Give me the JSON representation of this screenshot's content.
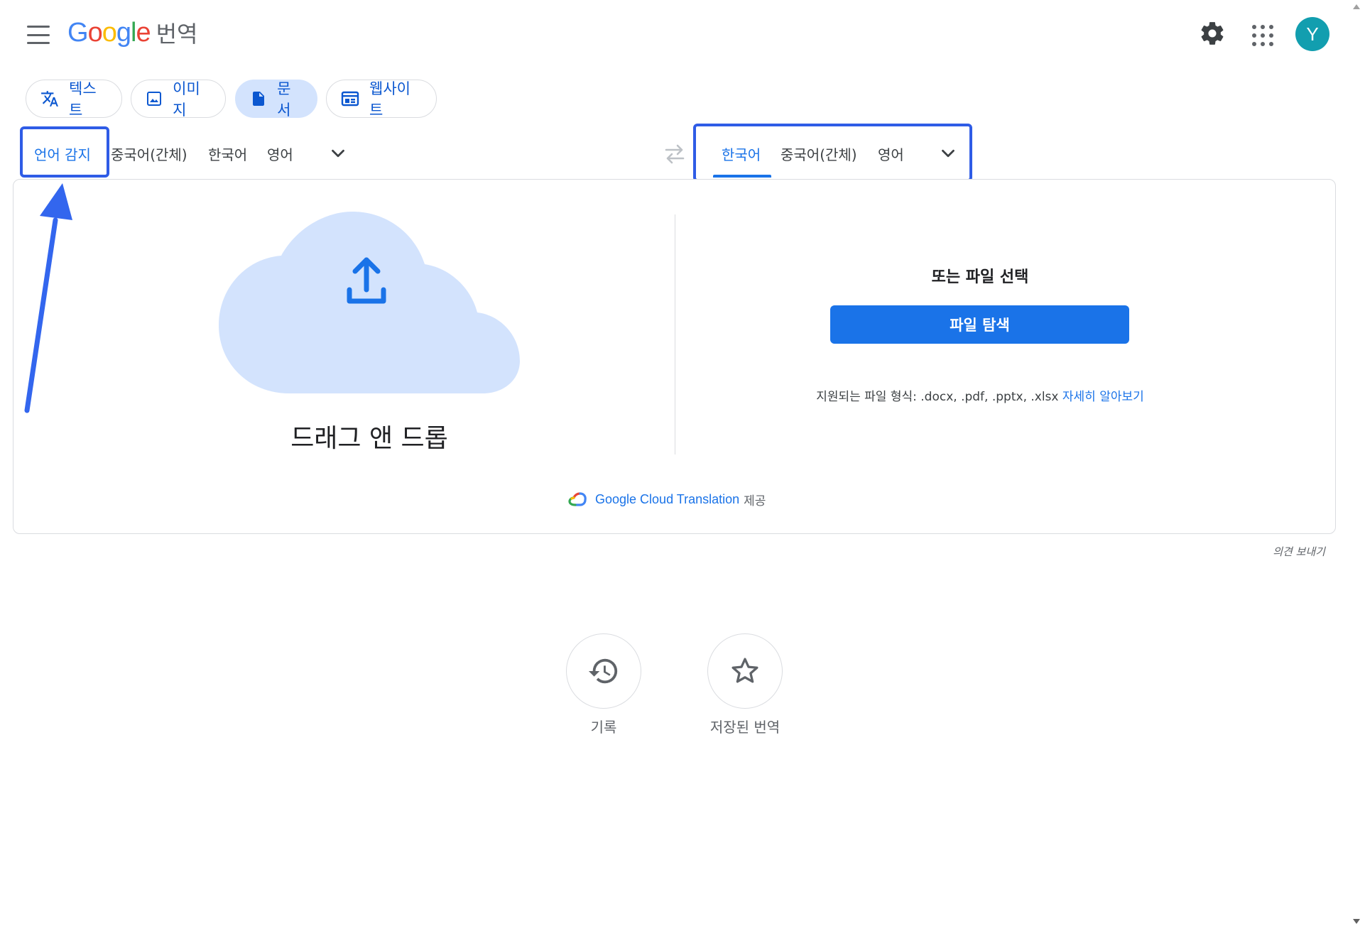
{
  "app": {
    "logo_letters": [
      "G",
      "o",
      "o",
      "g",
      "l",
      "e"
    ],
    "logo_colors": [
      "#4285f4",
      "#ea4335",
      "#fbbc05",
      "#4285f4",
      "#34a853",
      "#ea4335"
    ],
    "service_name": "번역",
    "avatar_initial": "Y",
    "avatar_color": "#129eaf"
  },
  "modes": {
    "text": "텍스트",
    "image": "이미지",
    "document": "문서",
    "website": "웹사이트",
    "active": "document"
  },
  "source_langs": {
    "detect": "언어 감지",
    "items": [
      "중국어(간체)",
      "한국어",
      "영어"
    ]
  },
  "target_langs": {
    "items": [
      "한국어",
      "중국어(간체)",
      "영어"
    ],
    "selected_index": 0
  },
  "upload": {
    "drag_title": "드래그 앤 드롭",
    "or_label": "또는 파일 선택",
    "browse_button": "파일 탐색",
    "formats_text": "지원되는 파일 형식: .docx, .pdf, .pptx, .xlsx",
    "learn_more": "자세히 알아보기"
  },
  "credit": {
    "brand": "Google Cloud Translation",
    "suffix": "제공"
  },
  "feedback": "의견 보내기",
  "bottom": {
    "history": "기록",
    "saved": "저장된 번역"
  },
  "colors": {
    "accent": "#1a73e8",
    "chip_active_bg": "#d3e3fd",
    "cloud": "#d3e3fd",
    "annotation": "#2f5ce6"
  },
  "icons": [
    "menu-icon",
    "gear-icon",
    "apps-grid-icon",
    "translate-icon",
    "image-icon",
    "document-icon",
    "website-icon",
    "swap-icon",
    "chevron-down-icon",
    "cloud-upload-icon",
    "google-cloud-icon",
    "history-icon",
    "star-icon"
  ]
}
